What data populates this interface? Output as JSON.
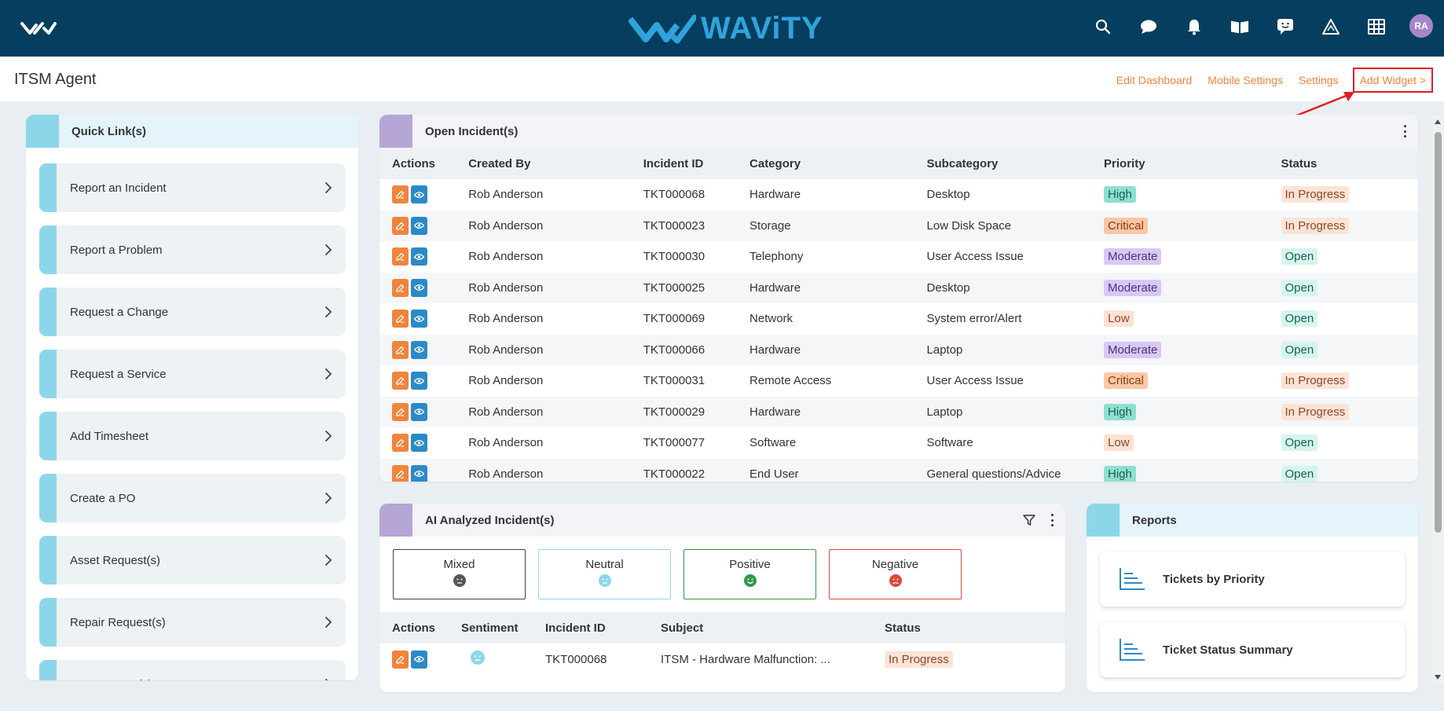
{
  "topbar": {
    "brand": "WAViTY",
    "avatar_initials": "RA",
    "icons": [
      "search-icon",
      "chat-icon",
      "bell-icon",
      "book-icon",
      "feedback-icon",
      "warning-triangle-icon",
      "grid-icon"
    ]
  },
  "header": {
    "page_title": "ITSM Agent",
    "links": {
      "edit_dashboard": "Edit Dashboard",
      "mobile_settings": "Mobile Settings",
      "settings": "Settings",
      "add_widget": "Add Widget >"
    }
  },
  "quick_links": {
    "title": "Quick Link(s)",
    "items": [
      {
        "label": "Report an Incident"
      },
      {
        "label": "Report a Problem"
      },
      {
        "label": "Request a Change"
      },
      {
        "label": "Request a Service"
      },
      {
        "label": "Add Timesheet"
      },
      {
        "label": "Create a PO"
      },
      {
        "label": "Asset Request(s)"
      },
      {
        "label": "Repair Request(s)"
      },
      {
        "label": "Asset Return(s)"
      }
    ]
  },
  "open_incidents": {
    "title": "Open Incident(s)",
    "columns": [
      "Actions",
      "Created By",
      "Incident ID",
      "Category",
      "Subcategory",
      "Priority",
      "Status"
    ],
    "rows": [
      {
        "created_by": "Rob Anderson",
        "id": "TKT000068",
        "category": "Hardware",
        "subcategory": "Desktop",
        "priority": "High",
        "status": "In Progress"
      },
      {
        "created_by": "Rob Anderson",
        "id": "TKT000023",
        "category": "Storage",
        "subcategory": "Low Disk Space",
        "priority": "Critical",
        "status": "In Progress"
      },
      {
        "created_by": "Rob Anderson",
        "id": "TKT000030",
        "category": "Telephony",
        "subcategory": "User Access Issue",
        "priority": "Moderate",
        "status": "Open"
      },
      {
        "created_by": "Rob Anderson",
        "id": "TKT000025",
        "category": "Hardware",
        "subcategory": "Desktop",
        "priority": "Moderate",
        "status": "Open"
      },
      {
        "created_by": "Rob Anderson",
        "id": "TKT000069",
        "category": "Network",
        "subcategory": "System error/Alert",
        "priority": "Low",
        "status": "Open"
      },
      {
        "created_by": "Rob Anderson",
        "id": "TKT000066",
        "category": "Hardware",
        "subcategory": "Laptop",
        "priority": "Moderate",
        "status": "Open"
      },
      {
        "created_by": "Rob Anderson",
        "id": "TKT000031",
        "category": "Remote Access",
        "subcategory": "User Access Issue",
        "priority": "Critical",
        "status": "In Progress"
      },
      {
        "created_by": "Rob Anderson",
        "id": "TKT000029",
        "category": "Hardware",
        "subcategory": "Laptop",
        "priority": "High",
        "status": "In Progress"
      },
      {
        "created_by": "Rob Anderson",
        "id": "TKT000077",
        "category": "Software",
        "subcategory": "Software",
        "priority": "Low",
        "status": "Open"
      },
      {
        "created_by": "Rob Anderson",
        "id": "TKT000022",
        "category": "End User",
        "subcategory": "General questions/Advice",
        "priority": "High",
        "status": "Open"
      }
    ]
  },
  "ai_incidents": {
    "title": "AI Analyzed Incident(s)",
    "sentiments": {
      "mixed": "Mixed",
      "neutral": "Neutral",
      "positive": "Positive",
      "negative": "Negative"
    },
    "columns": [
      "Actions",
      "Sentiment",
      "Incident ID",
      "Subject",
      "Status"
    ],
    "rows": [
      {
        "sentiment": "neutral",
        "id": "TKT000068",
        "subject": "ITSM - Hardware Malfunction: ...",
        "status": "In Progress"
      }
    ]
  },
  "reports": {
    "title": "Reports",
    "items": [
      {
        "label": "Tickets by Priority"
      },
      {
        "label": "Ticket Status Summary"
      }
    ]
  },
  "colors": {
    "topbar": "#053e5e",
    "brand": "#2fa4dc",
    "link": "#f0843d",
    "highlight": "#e11f26"
  }
}
